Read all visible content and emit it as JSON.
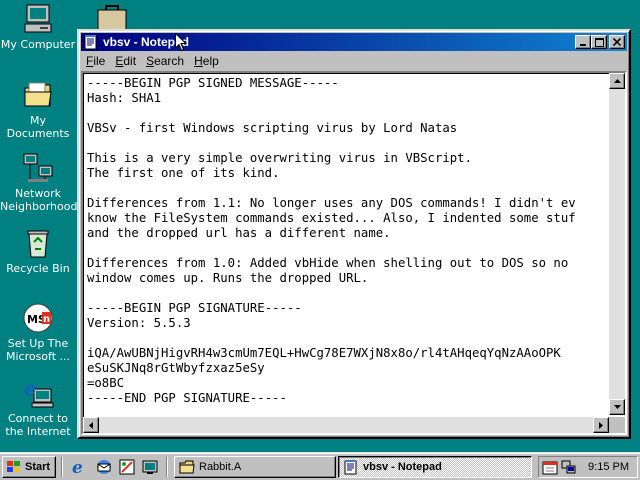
{
  "desktop": {
    "icons": [
      {
        "label": "My Computer"
      },
      {
        "label": "My Documents"
      },
      {
        "label": "Network Neighborhood"
      },
      {
        "label": "Recycle Bin"
      },
      {
        "label": "Set Up The Microsoft ..."
      },
      {
        "label": "Connect to the Internet"
      }
    ]
  },
  "window": {
    "title": "vbsv - Notepad",
    "menu": [
      "File",
      "Edit",
      "Search",
      "Help"
    ],
    "menu_mnemonics": [
      "F",
      "E",
      "S",
      "H"
    ],
    "text_lines": [
      "-----BEGIN PGP SIGNED MESSAGE-----",
      "Hash: SHA1",
      "",
      "VBSv - first Windows scripting virus by Lord Natas",
      "",
      "This is a very simple overwriting virus in VBScript.",
      "The first one of its kind.",
      "",
      "Differences from 1.1: No longer uses any DOS commands! I didn't ev",
      "know the FileSystem commands existed... Also, I indented some stuf",
      "and the dropped url has a different name.",
      "",
      "Differences from 1.0: Added vbHide when shelling out to DOS so no",
      "window comes up. Runs the dropped URL.",
      "",
      "-----BEGIN PGP SIGNATURE-----",
      "Version: 5.5.3",
      "",
      "iQA/AwUBNjHigvRH4w3cmUm7EQL+HwCg78E7WXjN8x8o/rl4tAHqeqYqNzAAoOPK",
      "eSuSKJNq8rGtWbyfzxaz5eSy",
      "=o8BC",
      "-----END PGP SIGNATURE-----"
    ]
  },
  "taskbar": {
    "start_label": "Start",
    "tasks": [
      {
        "label": "Rabbit.A",
        "active": false
      },
      {
        "label": "vbsv - Notepad",
        "active": true
      }
    ],
    "clock": "9:15 PM"
  },
  "colors": {
    "desktop": "#008080",
    "titlebar_start": "#000080",
    "titlebar_end": "#1084d0",
    "chrome": "#c0c0c0"
  }
}
